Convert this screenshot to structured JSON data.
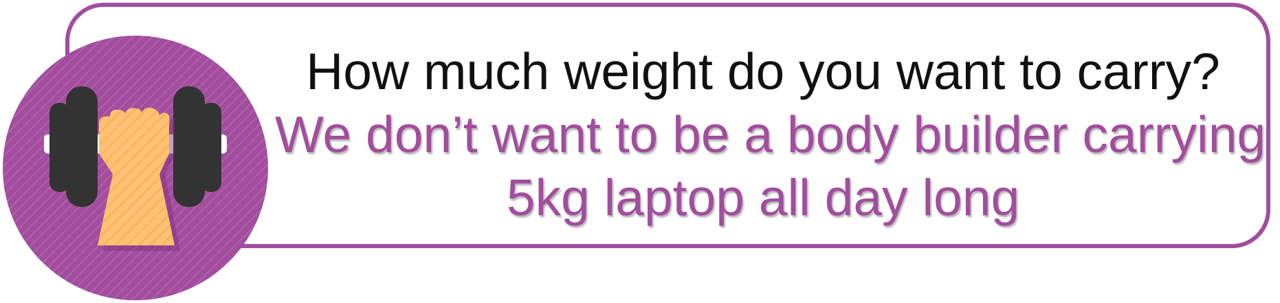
{
  "callout": {
    "question": "How much weight do you want to carry?",
    "answer_line1": "We don’t want to be a body builder carrying",
    "answer_line2": "5kg laptop all day long"
  },
  "icon": {
    "name": "dumbbell-in-hand-icon",
    "colors": {
      "circle": "#a24d9d",
      "weight": "#333333",
      "bar": "#ffffff",
      "hand": "#ffc274",
      "border": "#a24d9d"
    }
  }
}
